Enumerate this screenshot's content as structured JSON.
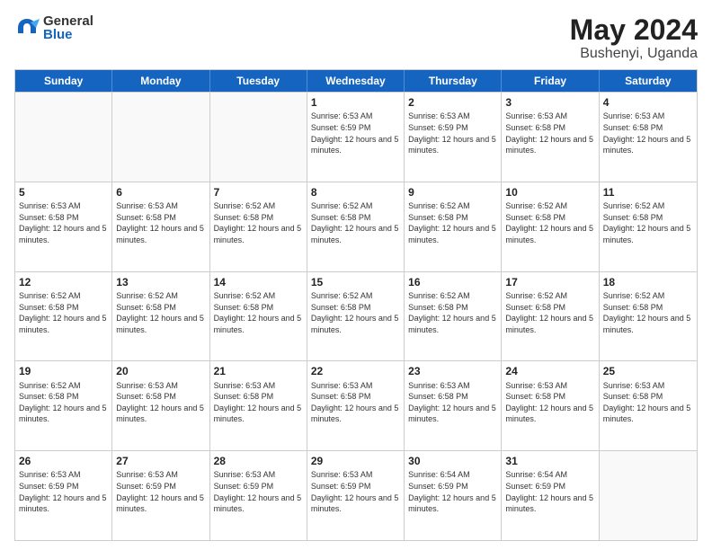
{
  "logo": {
    "general": "General",
    "blue": "Blue"
  },
  "title": {
    "month_year": "May 2024",
    "location": "Bushenyi, Uganda"
  },
  "header_days": [
    "Sunday",
    "Monday",
    "Tuesday",
    "Wednesday",
    "Thursday",
    "Friday",
    "Saturday"
  ],
  "rows": [
    [
      {
        "day": "",
        "sunrise": "",
        "sunset": "",
        "daylight": "",
        "empty": true
      },
      {
        "day": "",
        "sunrise": "",
        "sunset": "",
        "daylight": "",
        "empty": true
      },
      {
        "day": "",
        "sunrise": "",
        "sunset": "",
        "daylight": "",
        "empty": true
      },
      {
        "day": "1",
        "sunrise": "Sunrise: 6:53 AM",
        "sunset": "Sunset: 6:59 PM",
        "daylight": "Daylight: 12 hours and 5 minutes.",
        "empty": false
      },
      {
        "day": "2",
        "sunrise": "Sunrise: 6:53 AM",
        "sunset": "Sunset: 6:59 PM",
        "daylight": "Daylight: 12 hours and 5 minutes.",
        "empty": false
      },
      {
        "day": "3",
        "sunrise": "Sunrise: 6:53 AM",
        "sunset": "Sunset: 6:58 PM",
        "daylight": "Daylight: 12 hours and 5 minutes.",
        "empty": false
      },
      {
        "day": "4",
        "sunrise": "Sunrise: 6:53 AM",
        "sunset": "Sunset: 6:58 PM",
        "daylight": "Daylight: 12 hours and 5 minutes.",
        "empty": false
      }
    ],
    [
      {
        "day": "5",
        "sunrise": "Sunrise: 6:53 AM",
        "sunset": "Sunset: 6:58 PM",
        "daylight": "Daylight: 12 hours and 5 minutes.",
        "empty": false
      },
      {
        "day": "6",
        "sunrise": "Sunrise: 6:53 AM",
        "sunset": "Sunset: 6:58 PM",
        "daylight": "Daylight: 12 hours and 5 minutes.",
        "empty": false
      },
      {
        "day": "7",
        "sunrise": "Sunrise: 6:52 AM",
        "sunset": "Sunset: 6:58 PM",
        "daylight": "Daylight: 12 hours and 5 minutes.",
        "empty": false
      },
      {
        "day": "8",
        "sunrise": "Sunrise: 6:52 AM",
        "sunset": "Sunset: 6:58 PM",
        "daylight": "Daylight: 12 hours and 5 minutes.",
        "empty": false
      },
      {
        "day": "9",
        "sunrise": "Sunrise: 6:52 AM",
        "sunset": "Sunset: 6:58 PM",
        "daylight": "Daylight: 12 hours and 5 minutes.",
        "empty": false
      },
      {
        "day": "10",
        "sunrise": "Sunrise: 6:52 AM",
        "sunset": "Sunset: 6:58 PM",
        "daylight": "Daylight: 12 hours and 5 minutes.",
        "empty": false
      },
      {
        "day": "11",
        "sunrise": "Sunrise: 6:52 AM",
        "sunset": "Sunset: 6:58 PM",
        "daylight": "Daylight: 12 hours and 5 minutes.",
        "empty": false
      }
    ],
    [
      {
        "day": "12",
        "sunrise": "Sunrise: 6:52 AM",
        "sunset": "Sunset: 6:58 PM",
        "daylight": "Daylight: 12 hours and 5 minutes.",
        "empty": false
      },
      {
        "day": "13",
        "sunrise": "Sunrise: 6:52 AM",
        "sunset": "Sunset: 6:58 PM",
        "daylight": "Daylight: 12 hours and 5 minutes.",
        "empty": false
      },
      {
        "day": "14",
        "sunrise": "Sunrise: 6:52 AM",
        "sunset": "Sunset: 6:58 PM",
        "daylight": "Daylight: 12 hours and 5 minutes.",
        "empty": false
      },
      {
        "day": "15",
        "sunrise": "Sunrise: 6:52 AM",
        "sunset": "Sunset: 6:58 PM",
        "daylight": "Daylight: 12 hours and 5 minutes.",
        "empty": false
      },
      {
        "day": "16",
        "sunrise": "Sunrise: 6:52 AM",
        "sunset": "Sunset: 6:58 PM",
        "daylight": "Daylight: 12 hours and 5 minutes.",
        "empty": false
      },
      {
        "day": "17",
        "sunrise": "Sunrise: 6:52 AM",
        "sunset": "Sunset: 6:58 PM",
        "daylight": "Daylight: 12 hours and 5 minutes.",
        "empty": false
      },
      {
        "day": "18",
        "sunrise": "Sunrise: 6:52 AM",
        "sunset": "Sunset: 6:58 PM",
        "daylight": "Daylight: 12 hours and 5 minutes.",
        "empty": false
      }
    ],
    [
      {
        "day": "19",
        "sunrise": "Sunrise: 6:52 AM",
        "sunset": "Sunset: 6:58 PM",
        "daylight": "Daylight: 12 hours and 5 minutes.",
        "empty": false
      },
      {
        "day": "20",
        "sunrise": "Sunrise: 6:53 AM",
        "sunset": "Sunset: 6:58 PM",
        "daylight": "Daylight: 12 hours and 5 minutes.",
        "empty": false
      },
      {
        "day": "21",
        "sunrise": "Sunrise: 6:53 AM",
        "sunset": "Sunset: 6:58 PM",
        "daylight": "Daylight: 12 hours and 5 minutes.",
        "empty": false
      },
      {
        "day": "22",
        "sunrise": "Sunrise: 6:53 AM",
        "sunset": "Sunset: 6:58 PM",
        "daylight": "Daylight: 12 hours and 5 minutes.",
        "empty": false
      },
      {
        "day": "23",
        "sunrise": "Sunrise: 6:53 AM",
        "sunset": "Sunset: 6:58 PM",
        "daylight": "Daylight: 12 hours and 5 minutes.",
        "empty": false
      },
      {
        "day": "24",
        "sunrise": "Sunrise: 6:53 AM",
        "sunset": "Sunset: 6:58 PM",
        "daylight": "Daylight: 12 hours and 5 minutes.",
        "empty": false
      },
      {
        "day": "25",
        "sunrise": "Sunrise: 6:53 AM",
        "sunset": "Sunset: 6:58 PM",
        "daylight": "Daylight: 12 hours and 5 minutes.",
        "empty": false
      }
    ],
    [
      {
        "day": "26",
        "sunrise": "Sunrise: 6:53 AM",
        "sunset": "Sunset: 6:59 PM",
        "daylight": "Daylight: 12 hours and 5 minutes.",
        "empty": false
      },
      {
        "day": "27",
        "sunrise": "Sunrise: 6:53 AM",
        "sunset": "Sunset: 6:59 PM",
        "daylight": "Daylight: 12 hours and 5 minutes.",
        "empty": false
      },
      {
        "day": "28",
        "sunrise": "Sunrise: 6:53 AM",
        "sunset": "Sunset: 6:59 PM",
        "daylight": "Daylight: 12 hours and 5 minutes.",
        "empty": false
      },
      {
        "day": "29",
        "sunrise": "Sunrise: 6:53 AM",
        "sunset": "Sunset: 6:59 PM",
        "daylight": "Daylight: 12 hours and 5 minutes.",
        "empty": false
      },
      {
        "day": "30",
        "sunrise": "Sunrise: 6:54 AM",
        "sunset": "Sunset: 6:59 PM",
        "daylight": "Daylight: 12 hours and 5 minutes.",
        "empty": false
      },
      {
        "day": "31",
        "sunrise": "Sunrise: 6:54 AM",
        "sunset": "Sunset: 6:59 PM",
        "daylight": "Daylight: 12 hours and 5 minutes.",
        "empty": false
      },
      {
        "day": "",
        "sunrise": "",
        "sunset": "",
        "daylight": "",
        "empty": true
      }
    ]
  ]
}
